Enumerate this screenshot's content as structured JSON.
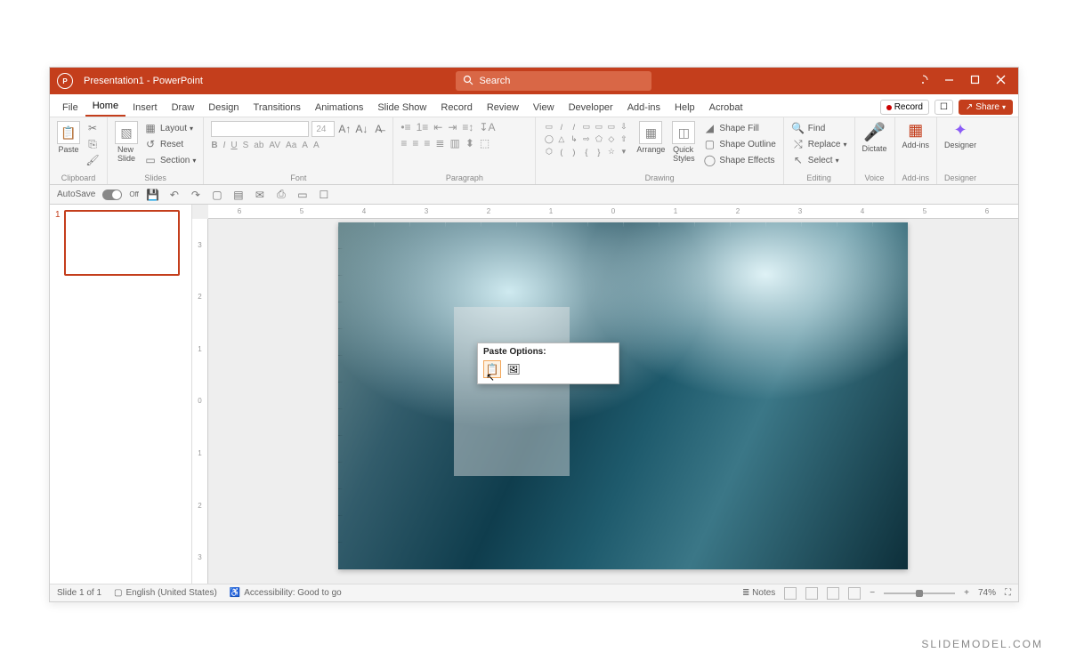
{
  "title": "Presentation1 - PowerPoint",
  "search": {
    "placeholder": "Search"
  },
  "tabs": [
    "File",
    "Home",
    "Insert",
    "Draw",
    "Design",
    "Transitions",
    "Animations",
    "Slide Show",
    "Record",
    "Review",
    "View",
    "Developer",
    "Add-ins",
    "Help",
    "Acrobat"
  ],
  "active_tab": "Home",
  "topbar": {
    "record": "Record",
    "share": "Share"
  },
  "ribbon": {
    "clipboard": {
      "label": "Clipboard",
      "paste": "Paste"
    },
    "slides": {
      "label": "Slides",
      "new_slide": "New\nSlide",
      "layout": "Layout",
      "reset": "Reset",
      "section": "Section"
    },
    "font": {
      "label": "Font",
      "size": "24",
      "buttons": [
        "B",
        "I",
        "U",
        "S",
        "ab",
        "AV",
        "Aa",
        "A",
        "A"
      ]
    },
    "paragraph": {
      "label": "Paragraph"
    },
    "drawing": {
      "label": "Drawing",
      "arrange": "Arrange",
      "quick": "Quick\nStyles",
      "shape_fill": "Shape Fill",
      "shape_outline": "Shape Outline",
      "shape_effects": "Shape Effects"
    },
    "editing": {
      "label": "Editing",
      "find": "Find",
      "replace": "Replace",
      "select": "Select"
    },
    "voice": {
      "label": "Voice",
      "dictate": "Dictate"
    },
    "addins": {
      "label": "Add-ins",
      "btn": "Add-ins"
    },
    "designer": {
      "label": "Designer",
      "btn": "Designer"
    }
  },
  "qat": {
    "autosave": "AutoSave",
    "off": "Off"
  },
  "thumb": {
    "num": "1"
  },
  "ruler_h": [
    "6",
    "5",
    "4",
    "3",
    "2",
    "1",
    "0",
    "1",
    "2",
    "3",
    "4",
    "5",
    "6"
  ],
  "ruler_v": [
    "3",
    "2",
    "1",
    "0",
    "1",
    "2",
    "3"
  ],
  "context": {
    "title": "Paste Options:"
  },
  "status": {
    "slide": "Slide 1 of 1",
    "lang": "English (United States)",
    "access": "Accessibility: Good to go",
    "notes": "Notes",
    "zoom": "74%"
  },
  "watermark": "SLIDEMODEL.COM"
}
